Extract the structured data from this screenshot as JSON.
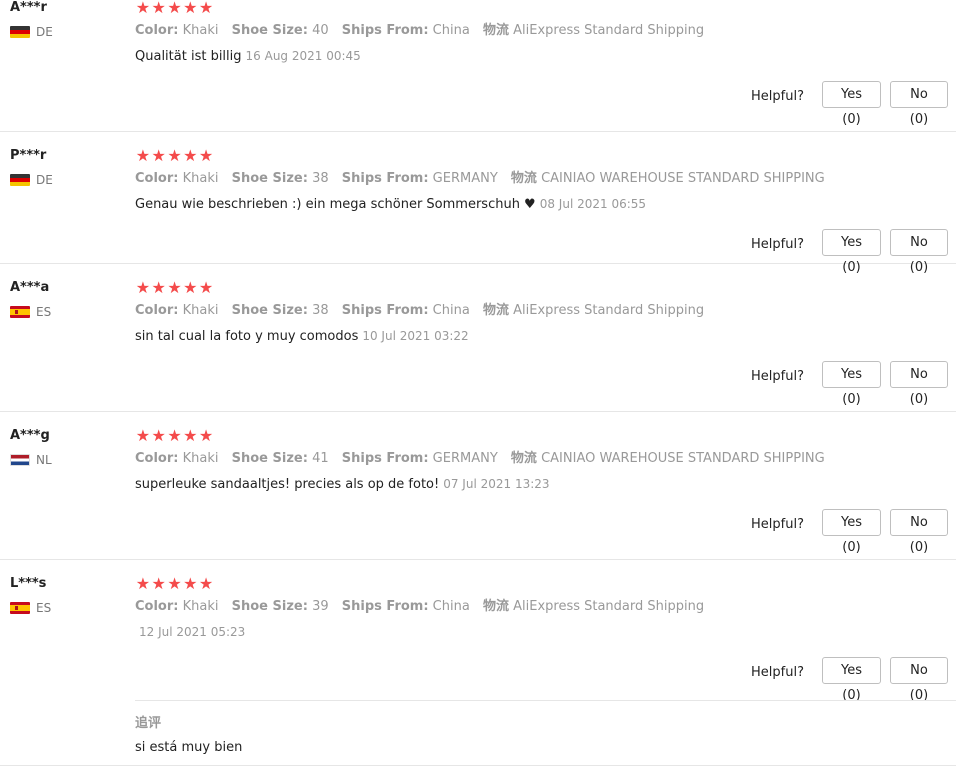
{
  "reviews": [
    {
      "user": "A***r",
      "country": "DE",
      "flag": "de",
      "stars": [
        "★",
        "★",
        "★",
        "★",
        "★"
      ],
      "color_key": "Color:",
      "color_val": "Khaki",
      "size_key": "Shoe Size:",
      "size_val": "40",
      "ships_key": "Ships From:",
      "ships_val": "China",
      "logistics_key": "物流",
      "logistics_val": "AliExpress Standard Shipping",
      "text": "Qualität ist billig",
      "date": "16 Aug 2021 00:45",
      "helpful_label": "Helpful?",
      "yes": "Yes (0)",
      "no": "No (0)"
    },
    {
      "user": "P***r",
      "country": "DE",
      "flag": "de",
      "stars": [
        "★",
        "★",
        "★",
        "★",
        "★"
      ],
      "color_key": "Color:",
      "color_val": "Khaki",
      "size_key": "Shoe Size:",
      "size_val": "38",
      "ships_key": "Ships From:",
      "ships_val": "GERMANY",
      "logistics_key": "物流",
      "logistics_val": "CAINIAO WAREHOUSE STANDARD SHIPPING",
      "text": "Genau wie beschrieben :) ein mega schöner Sommerschuh ♥",
      "date": "08 Jul 2021 06:55",
      "helpful_label": "Helpful?",
      "yes": "Yes (0)",
      "no": "No (0)"
    },
    {
      "user": "A***a",
      "country": "ES",
      "flag": "es",
      "stars": [
        "★",
        "★",
        "★",
        "★",
        "★"
      ],
      "color_key": "Color:",
      "color_val": "Khaki",
      "size_key": "Shoe Size:",
      "size_val": "38",
      "ships_key": "Ships From:",
      "ships_val": "China",
      "logistics_key": "物流",
      "logistics_val": "AliExpress Standard Shipping",
      "text": "sin tal cual la foto y muy comodos",
      "date": "10 Jul 2021 03:22",
      "helpful_label": "Helpful?",
      "yes": "Yes (0)",
      "no": "No (0)"
    },
    {
      "user": "A***g",
      "country": "NL",
      "flag": "nl",
      "stars": [
        "★",
        "★",
        "★",
        "★",
        "★"
      ],
      "color_key": "Color:",
      "color_val": "Khaki",
      "size_key": "Shoe Size:",
      "size_val": "41",
      "ships_key": "Ships From:",
      "ships_val": "GERMANY",
      "logistics_key": "物流",
      "logistics_val": "CAINIAO WAREHOUSE STANDARD SHIPPING",
      "text": "superleuke sandaaltjes! precies als op de foto!",
      "date": "07 Jul 2021 13:23",
      "helpful_label": "Helpful?",
      "yes": "Yes (0)",
      "no": "No (0)"
    },
    {
      "user": "L***s",
      "country": "ES",
      "flag": "es",
      "stars": [
        "★",
        "★",
        "★",
        "★",
        "★"
      ],
      "color_key": "Color:",
      "color_val": "Khaki",
      "size_key": "Shoe Size:",
      "size_val": "39",
      "ships_key": "Ships From:",
      "ships_val": "China",
      "logistics_key": "物流",
      "logistics_val": "AliExpress Standard Shipping",
      "text": "",
      "date": "12 Jul 2021 05:23",
      "helpful_label": "Helpful?",
      "yes": "Yes (0)",
      "no": "No (0)",
      "additional_title": "追评",
      "additional_text": "si está muy bien"
    }
  ],
  "colors": {
    "star": "#f44b4b",
    "muted": "#999999",
    "text": "#222222",
    "border": "#e6e6e6"
  }
}
